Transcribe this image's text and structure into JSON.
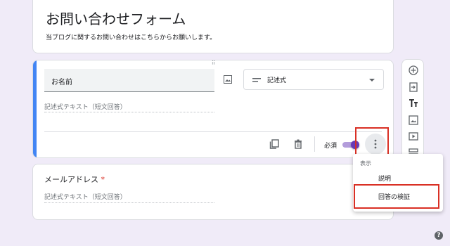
{
  "header": {
    "title": "お問い合わせフォーム",
    "description": "当ブログに関するお問い合わせはこちらからお願いします。"
  },
  "question_1": {
    "title_value": "お名前",
    "type_label": "記述式",
    "answer_placeholder": "記述式テキスト（短文回答）",
    "required_label": "必須",
    "required": true
  },
  "question_2": {
    "title": "メールアドレス",
    "required_mark": "*",
    "answer_placeholder": "記述式テキスト（短文回答）"
  },
  "more_menu": {
    "section_label": "表示",
    "items": [
      {
        "label": "説明"
      },
      {
        "label": "回答の検証"
      }
    ]
  },
  "side_toolbar": {
    "icons": [
      "add-question-icon",
      "import-questions-icon",
      "add-title-icon",
      "add-image-icon",
      "add-video-icon",
      "add-section-icon"
    ]
  },
  "help_icon_glyph": "?",
  "colors": {
    "background": "#f0ebf8",
    "accent": "#4285f4",
    "toggle": "#673ab7",
    "highlight": "#d93025"
  }
}
